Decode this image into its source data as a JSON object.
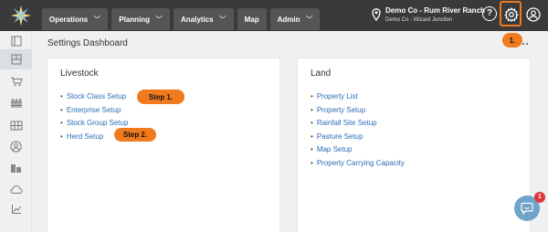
{
  "nav": {
    "tabs": [
      {
        "label": "Operations",
        "dropdown": true
      },
      {
        "label": "Planning",
        "dropdown": true
      },
      {
        "label": "Analytics",
        "dropdown": true
      },
      {
        "label": "Map",
        "dropdown": false
      },
      {
        "label": "Admin",
        "dropdown": true
      }
    ]
  },
  "account": {
    "line1": "Demo Co - Rum River Ranch",
    "line2": "Demo Co - Wizard Junction"
  },
  "header_icons": {
    "help": "?",
    "settings": "gear-icon",
    "user": "user-circle-icon"
  },
  "sidebar": {
    "items": [
      "panel-icon",
      "dashboard-icon",
      "cart-icon",
      "fence-icon",
      "fence-grid-icon",
      "person-circle-icon",
      "buildings-icon",
      "cloud-icon",
      "chart-icon"
    ]
  },
  "page": {
    "title": "Settings Dashboard",
    "more": "..."
  },
  "livestock": {
    "title": "Livestock",
    "links": [
      "Stock Class Setup",
      "Enterprise Setup",
      "Stock Group Setup",
      "Herd Setup"
    ]
  },
  "land": {
    "title": "Land",
    "links": [
      "Property List",
      "Property Setup",
      "Rainfall Site Setup",
      "Pasture Setup",
      "Map Setup",
      "Property Carrying Capacity"
    ]
  },
  "callouts": {
    "step1": "Step 1.",
    "step2": "Step 2.",
    "c1": "1."
  },
  "chat": {
    "badge": "1"
  },
  "colors": {
    "topbar": "#3a3a3a",
    "tab": "#555555",
    "link": "#2d6eb5",
    "annotation": "#f07a1e",
    "chat": "#6fa3c8",
    "badge": "#e0353b"
  }
}
